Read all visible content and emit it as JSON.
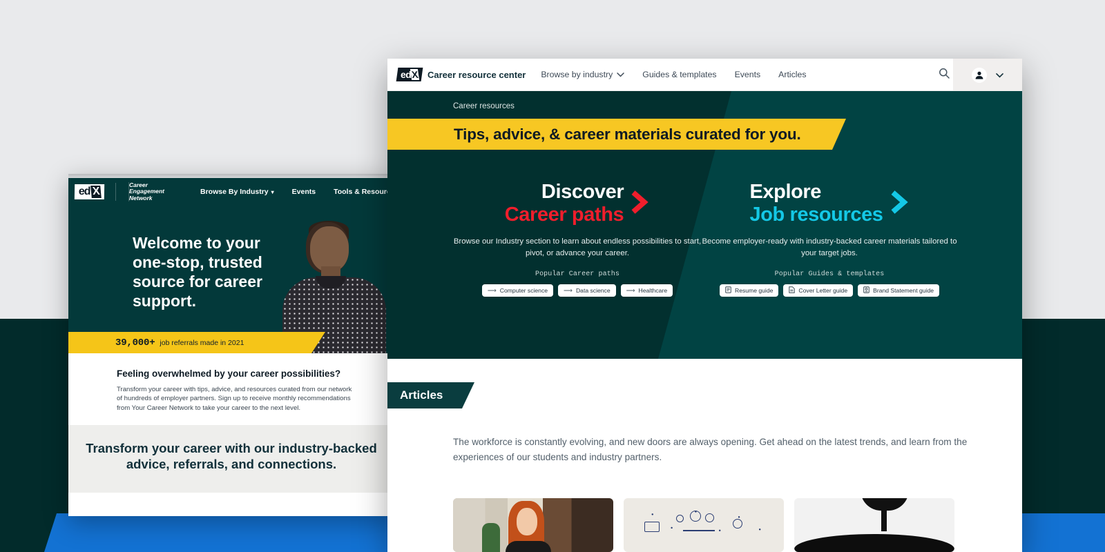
{
  "back_window": {
    "brand": {
      "logo": "edx-logo",
      "name_lines": [
        "Career",
        "Engagement",
        "Network"
      ]
    },
    "nav": [
      {
        "label": "Browse By Industry",
        "icon": "chevron-down-icon"
      },
      {
        "label": "Events"
      },
      {
        "label": "Tools & Resources"
      }
    ],
    "hero": {
      "headline": "Welcome to your one-stop, trusted source for career support."
    },
    "stat_banner": {
      "number": "39,000+",
      "label": "job referrals made in 2021"
    },
    "section": {
      "heading": "Feeling overwhelmed by your career possibilities?",
      "body": "Transform your career with tips, advice, and resources curated from our network of hundreds of employer partners. Sign up to receive monthly recommendations from Your Career Network to take your career to the next level."
    },
    "cta": {
      "heading": "Transform your career with our industry-backed advice, referrals, and connections."
    }
  },
  "front_window": {
    "header": {
      "logo": "edx-logo",
      "brand": "Career resource center",
      "nav": [
        {
          "label": "Browse by industry",
          "icon": "chevron-down-icon"
        },
        {
          "label": "Guides & templates"
        },
        {
          "label": "Events"
        },
        {
          "label": "Articles"
        }
      ],
      "search_icon": "search-icon",
      "account_icon": "user-avatar-icon",
      "account_chevron": "chevron-down-icon"
    },
    "hero": {
      "breadcrumb": "Career resources",
      "banner_title": "Tips, advice, & career materials curated for you.",
      "promos": [
        {
          "title_top": "Discover",
          "title_bottom": "Career paths",
          "accent": "#f01e2c",
          "arrow_icon": "chevron-right-icon",
          "description": "Browse our Industry section to learn about endless possibilities to start, pivot, or advance your career.",
          "chips_label": "Popular Career paths",
          "chips": [
            {
              "icon": "arrow-right-icon",
              "label": "Computer science"
            },
            {
              "icon": "arrow-right-icon",
              "label": "Data science"
            },
            {
              "icon": "arrow-right-icon",
              "label": "Healthcare"
            }
          ]
        },
        {
          "title_top": "Explore",
          "title_bottom": "Job resources",
          "accent": "#14c8e6",
          "arrow_icon": "chevron-right-icon",
          "description": "Become employer-ready with industry-backed career materials tailored to your target jobs.",
          "chips_label": "Popular Guides & templates",
          "chips": [
            {
              "icon": "resume-document-icon",
              "label": "Resume guide"
            },
            {
              "icon": "letter-document-icon",
              "label": "Cover Letter guide"
            },
            {
              "icon": "badge-document-icon",
              "label": "Brand Statement guide"
            }
          ]
        }
      ]
    },
    "articles": {
      "tab_label": "Articles",
      "intro": "The workforce is constantly evolving, and new doors are always opening. Get ahead on the latest trends, and learn from the experiences of our students and industry partners.",
      "cards": [
        {
          "thumbnail": "woman-on-video-call-photo"
        },
        {
          "thumbnail": "idea-doodles-whiteboard-photo"
        },
        {
          "thumbnail": "desk-lamp-photo"
        }
      ]
    }
  },
  "theme": {
    "page_bg_top": "#e9eaec",
    "page_bg_bottom": "#022b2b",
    "accent_blue_band": "#1372d3",
    "brand_dark_green": "#02302f",
    "brand_teal": "#014343",
    "brand_yellow": "#f7c723",
    "brand_red": "#f01e2c",
    "brand_cyan": "#14c8e6"
  }
}
